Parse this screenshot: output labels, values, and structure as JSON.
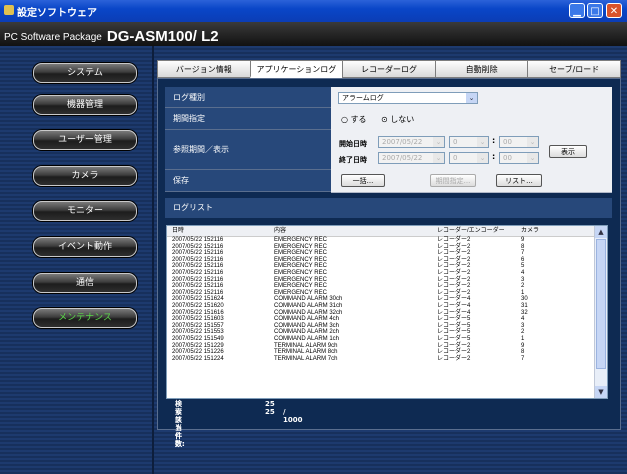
{
  "window": {
    "title": "設定ソフトウェア"
  },
  "header": {
    "prefix": "PC Software Package",
    "product": "DG-ASM100/ L2"
  },
  "nav": [
    {
      "label": "システム",
      "active": false
    },
    {
      "label": "機器管理",
      "active": false
    },
    {
      "label": "ユーザー管理",
      "active": false
    },
    {
      "label": "カメラ",
      "active": false
    },
    {
      "label": "モニター",
      "active": false
    },
    {
      "label": "イベント動作",
      "active": false
    },
    {
      "label": "通信",
      "active": false
    },
    {
      "label": "メンテナンス",
      "active": true
    }
  ],
  "tabs": [
    {
      "label": "バージョン情報",
      "active": false
    },
    {
      "label": "アプリケーションログ",
      "active": true
    },
    {
      "label": "レコーダーログ",
      "active": false
    },
    {
      "label": "自動削除",
      "active": false
    },
    {
      "label": "セーブ/ロード",
      "active": false
    }
  ],
  "form": {
    "log_type_label": "ログ種別",
    "log_type_value": "アラームログ",
    "period_label": "期間指定",
    "period_on": "する",
    "period_off": "しない",
    "period_selected": "しない",
    "ref_label": "参照期間／表示",
    "start_label": "開始日時",
    "end_label": "終了日時",
    "start_date": "2007/05/22",
    "start_hour": "0",
    "start_min": "00",
    "end_date": "2007/05/22",
    "end_hour": "0",
    "end_min": "00",
    "show_button": "表示",
    "save_label": "保存",
    "save_all_button": "一括...",
    "save_period_button": "期間指定...",
    "list_button": "リスト..."
  },
  "loglist": {
    "title": "ログリスト",
    "columns": [
      "日時",
      "内容",
      "レコーダー/エンコーダー",
      "カメラ"
    ],
    "rows": [
      [
        "2007/05/22 152116",
        "EMERGENCY REC",
        "レコーダー2",
        "9"
      ],
      [
        "2007/05/22 152116",
        "EMERGENCY REC",
        "レコーダー2",
        "8"
      ],
      [
        "2007/05/22 152116",
        "EMERGENCY REC",
        "レコーダー2",
        "7"
      ],
      [
        "2007/05/22 152116",
        "EMERGENCY REC",
        "レコーダー2",
        "6"
      ],
      [
        "2007/05/22 152116",
        "EMERGENCY REC",
        "レコーダー2",
        "5"
      ],
      [
        "2007/05/22 152116",
        "EMERGENCY REC",
        "レコーダー2",
        "4"
      ],
      [
        "2007/05/22 152116",
        "EMERGENCY REC",
        "レコーダー2",
        "3"
      ],
      [
        "2007/05/22 152116",
        "EMERGENCY REC",
        "レコーダー2",
        "2"
      ],
      [
        "2007/05/22 152116",
        "EMERGENCY REC",
        "レコーダー2",
        "1"
      ],
      [
        "2007/05/22 151624",
        "COMMAND ALARM 30ch",
        "レコーダー4",
        "30"
      ],
      [
        "2007/05/22 151620",
        "COMMAND ALARM 31ch",
        "レコーダー4",
        "31"
      ],
      [
        "2007/05/22 151616",
        "COMMAND ALARM 32ch",
        "レコーダー4",
        "32"
      ],
      [
        "2007/05/22 151603",
        "COMMAND ALARM 4ch",
        "レコーダー5",
        "4"
      ],
      [
        "2007/05/22 151557",
        "COMMAND ALARM 3ch",
        "レコーダー5",
        "3"
      ],
      [
        "2007/05/22 151553",
        "COMMAND ALARM 2ch",
        "レコーダー5",
        "2"
      ],
      [
        "2007/05/22 151549",
        "COMMAND ALARM 1ch",
        "レコーダー5",
        "1"
      ],
      [
        "2007/05/22 151229",
        "TERMINAL ALARM 9ch",
        "レコーダー2",
        "9"
      ],
      [
        "2007/05/22 151226",
        "TERMINAL ALARM 8ch",
        "レコーダー2",
        "8"
      ],
      [
        "2007/05/22 151224",
        "TERMINAL ALARM 7ch",
        "レコーダー2",
        "7"
      ]
    ]
  },
  "stats": {
    "found_label": "検索該当件数:",
    "found_value": "25",
    "list_label": "リスト件数:",
    "list_value": "25",
    "list_total": "/ 1000"
  }
}
